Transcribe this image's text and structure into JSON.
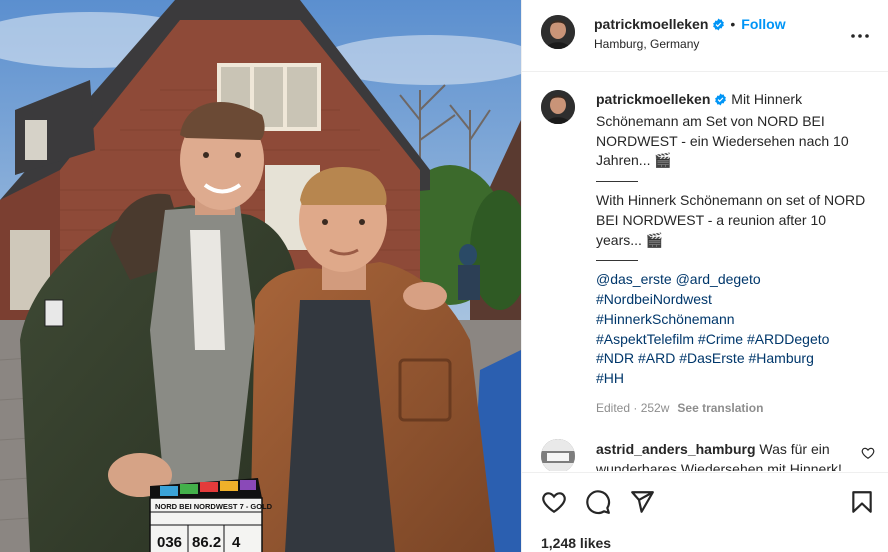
{
  "post": {
    "photo_alt": "photo",
    "clapper_title": "NORD BEI NORDWEST 7 - GOLD",
    "clapper_roll": "036",
    "clapper_scene": "86.2",
    "clapper_take": "4"
  },
  "header": {
    "username": "patrickmoelleken",
    "dot": "•",
    "follow_label": "Follow",
    "location": "Hamburg, Germany"
  },
  "caption": {
    "username": "patrickmoelleken",
    "line_de": "Mit Hinnerk Schönemann am Set von NORD BEI NORDWEST - ein Wiedersehen nach 10 Jahren... 🎬",
    "separator1": "———",
    "line_en": "With Hinnerk Schönemann on set of NORD BEI NORDWEST - a reunion after 10 years... 🎬",
    "separator2": "———",
    "mentions": "@das_erste @ard_degeto",
    "hashtags": [
      "#NordbeiNordwest",
      "#HinnerkSchönemann",
      "#AspektTelefilm #Crime #ARDDegeto",
      "#NDR #ARD #DasErste #Hamburg",
      "#HH"
    ],
    "edited": "Edited · 252w",
    "see_translation": "See translation"
  },
  "comment": {
    "username": "astrid_anders_hamburg",
    "text": "Was für ein wunderbares Wiedersehen mit Hinnerk! Wunderbar!"
  },
  "actions": {
    "likes": "1,248 likes"
  },
  "colors": {
    "accent": "#0095f6",
    "link": "#00376b",
    "muted": "#8e8e8e",
    "verified": "#0095f6"
  },
  "icons": [
    "verified-badge-icon",
    "more-options-icon",
    "heart-icon",
    "comment-icon",
    "share-icon",
    "bookmark-icon"
  ]
}
